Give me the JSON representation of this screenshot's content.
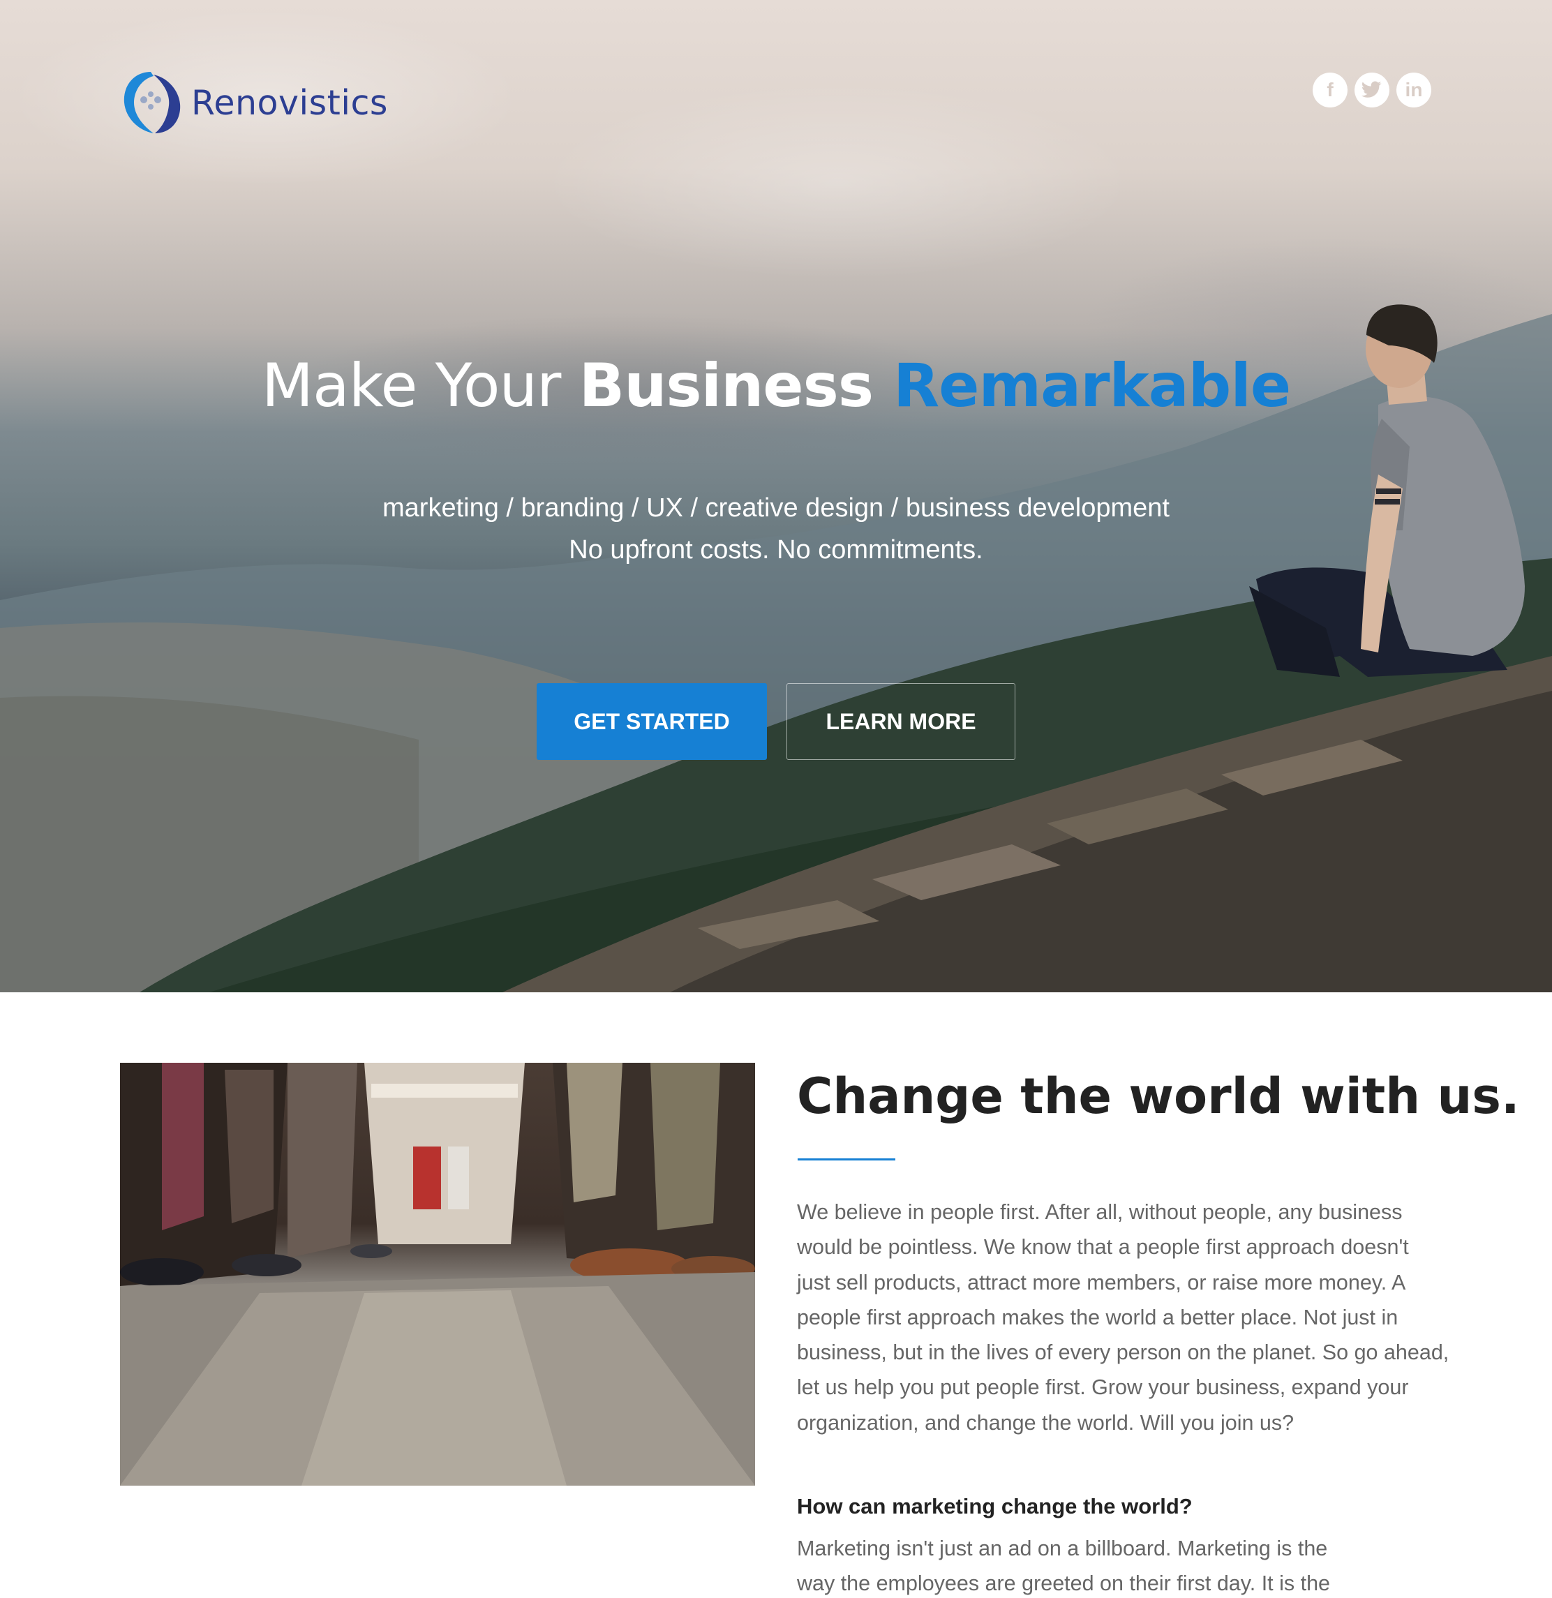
{
  "brand": {
    "name": "Renovistics",
    "primary_color": "#1680d4",
    "logo_text_color": "#2c3e92"
  },
  "social": [
    {
      "name": "facebook-icon",
      "glyph": "f"
    },
    {
      "name": "twitter-icon",
      "glyph": "t"
    },
    {
      "name": "linkedin-icon",
      "glyph": "in"
    }
  ],
  "hero": {
    "headline": {
      "part1": "Make Your ",
      "part2": "Business ",
      "part3": "Remarkable"
    },
    "services": "marketing / branding / UX / creative design / business development",
    "tagline": "No upfront costs. No commitments.",
    "cta_primary": "GET STARTED",
    "cta_secondary": "LEARN MORE"
  },
  "about": {
    "title": "Change the world with us.",
    "paragraph_lines": [
      "We believe in people first. After all, without people, any business",
      "would be pointless. We know that a people first approach doesn't",
      "just sell products, attract more members, or raise more money. A",
      "people first approach makes the world a better place. Not just in",
      "business, but in the lives of every person on the planet. So go ahead,",
      "let us help you put people first. Grow your business, expand your",
      "organization, and change the world. Will you join us?"
    ],
    "question": "How can marketing change the world?",
    "answer_lines": [
      "Marketing isn't just an ad on a billboard. Marketing is the",
      "way the employees are greeted on their first day. It is the"
    ]
  }
}
